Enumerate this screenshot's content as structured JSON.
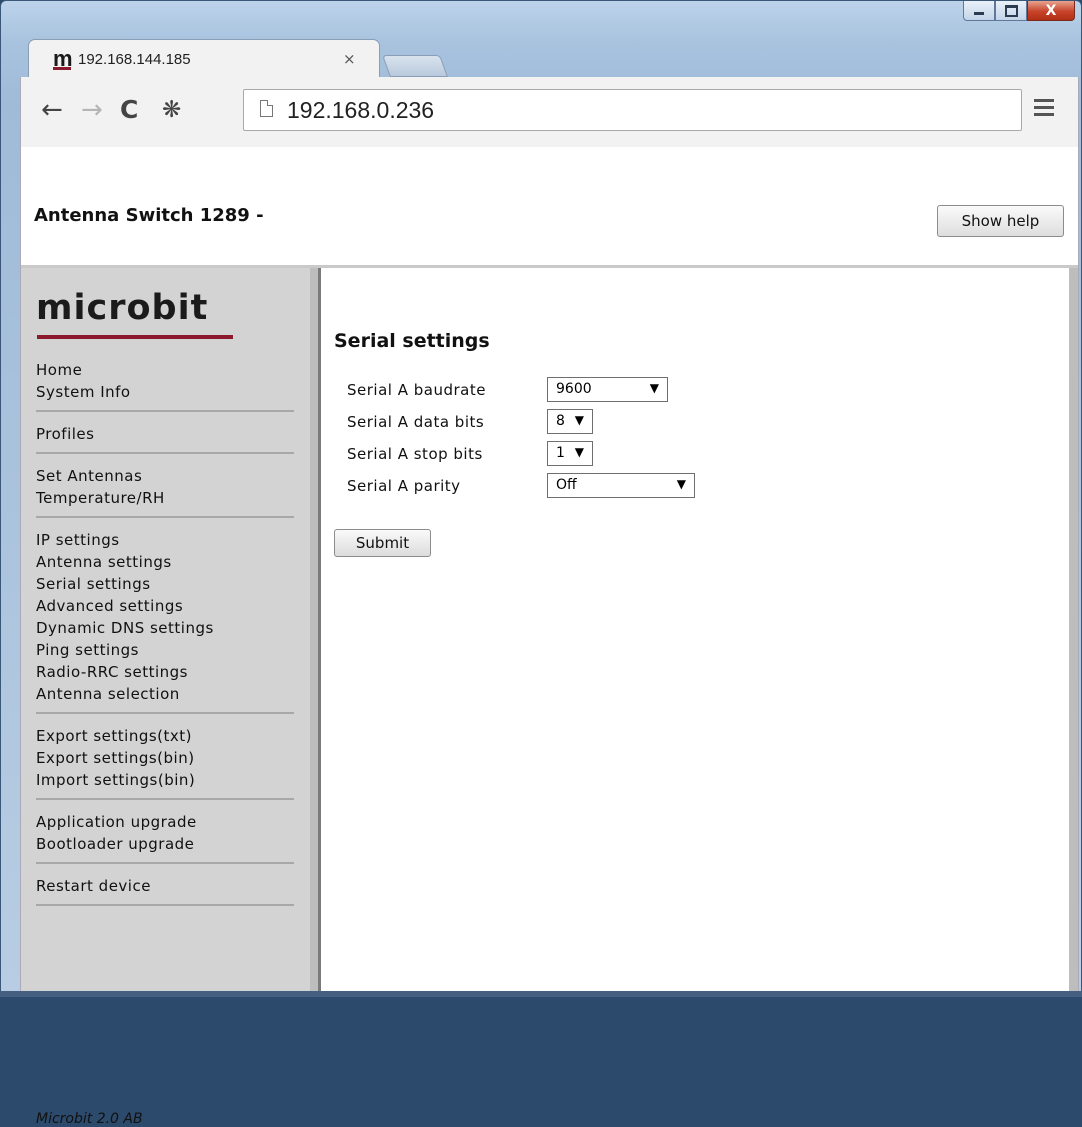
{
  "browser": {
    "tab_title": "192.168.144.185",
    "tab_favicon": "m",
    "tab_close": "×",
    "url": "192.168.0.236",
    "window_buttons": {
      "close": "X"
    }
  },
  "header": {
    "title": "Antenna Switch 1289 -",
    "help_button": "Show help"
  },
  "sidebar": {
    "logo": "microbit",
    "groups": [
      [
        "Home",
        "System Info"
      ],
      [
        "Profiles"
      ],
      [
        "Set Antennas",
        "Temperature/RH"
      ],
      [
        "IP settings",
        "Antenna settings",
        "Serial settings",
        "Advanced settings",
        "Dynamic DNS settings",
        "Ping settings",
        "Radio-RRC settings",
        "Antenna selection"
      ],
      [
        "Export settings(txt)",
        "Export settings(bin)",
        "Import settings(bin)"
      ],
      [
        "Application upgrade",
        "Bootloader upgrade"
      ],
      [
        "Restart device"
      ]
    ],
    "footer": "Microbit 2.0 AB"
  },
  "main": {
    "section_title": "Serial settings",
    "fields": [
      {
        "label": "Serial A baudrate",
        "value": "9600"
      },
      {
        "label": "Serial A data bits",
        "value": "8"
      },
      {
        "label": "Serial A stop bits",
        "value": "1"
      },
      {
        "label": "Serial A parity",
        "value": "Off"
      }
    ],
    "submit_label": "Submit"
  },
  "icons": {
    "back": "back-arrow-icon",
    "forward": "forward-arrow-icon",
    "reload": "reload-icon",
    "home": "home-icon",
    "page": "page-icon",
    "menu": "hamburger-menu-icon",
    "dropdown": "dropdown-arrow-icon"
  },
  "colors": {
    "brand": "#8b1a2e",
    "sidebar_bg": "#d3d3d3"
  }
}
